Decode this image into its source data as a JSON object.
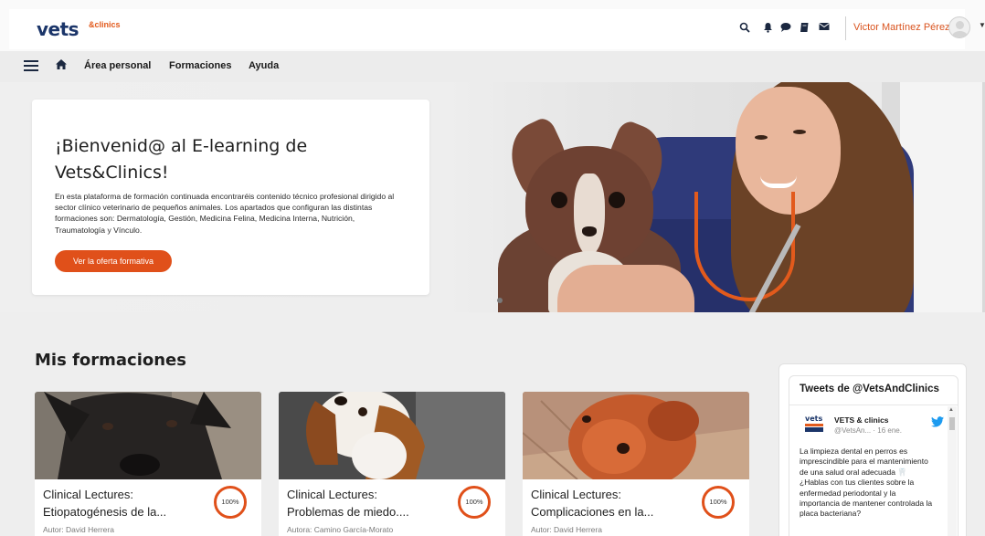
{
  "header": {
    "logo_text": "vets",
    "logo_sub": "&clinics",
    "user_name": "Victor Martínez Pérez",
    "icons": [
      "search-icon",
      "bell-icon",
      "chat-icon",
      "book-icon",
      "mail-icon"
    ]
  },
  "nav": {
    "items": [
      "Área personal",
      "Formaciones",
      "Ayuda"
    ]
  },
  "hero": {
    "title": "¡Bienvenid@ al E-learning de Vets&Clinics!",
    "text": "En esta plataforma de formación continuada encontraréis contenido técnico profesional dirigido al sector clínico veterinario de pequeños animales. Los apartados que configuran las distintas formaciones son: Dermatología, Gestión, Medicina Felina, Medicina Interna, Nutrición, Traumatología y Vínculo.",
    "button_label": "Ver la oferta formativa"
  },
  "main": {
    "section_title": "Mis formaciones",
    "courses": [
      {
        "title_line1": "Clinical Lectures:",
        "title_line2": "Etiopatogénesis de la...",
        "author": "Autor: David Herrera",
        "progress": "100%",
        "progress_value": 100
      },
      {
        "title_line1": "Clinical Lectures:",
        "title_line2": "Problemas de miedo....",
        "author": "Autora: Camino García-Morato",
        "progress": "100%",
        "progress_value": 100
      },
      {
        "title_line1": "Clinical Lectures:",
        "title_line2": "Complicaciones en la...",
        "author": "Autor: David Herrera",
        "progress": "100%",
        "progress_value": 100
      }
    ]
  },
  "twitter": {
    "title": "Tweets de @VetsAndClinics",
    "account_logo": "vets",
    "account_name": "VETS & clinics",
    "handle": "@VetsAn... · 16 ene.",
    "text": "La limpieza dental en perros es imprescindible para el mantenimiento de una salud oral adecuada 🦷 ¿Hablas con tus clientes sobre la enfermedad periodontal y la importancia de mantener controlada la placa bacteriana?"
  },
  "colors": {
    "accent": "#e0501a",
    "brand_navy": "#1b3569",
    "twitter_blue": "#1d9bf0"
  }
}
